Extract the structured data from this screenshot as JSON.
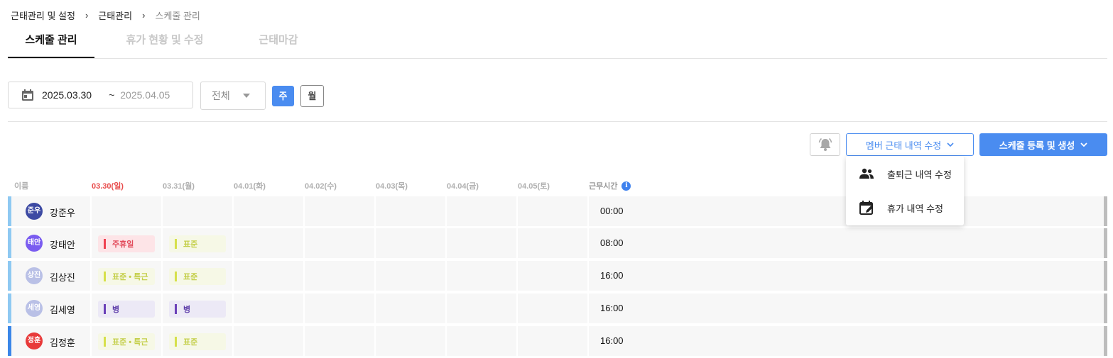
{
  "breadcrumb": [
    "근태관리 및 설정",
    "근태관리",
    "스케줄 관리"
  ],
  "tabs": [
    {
      "label": "스케줄 관리",
      "active": true
    },
    {
      "label": "휴가 현황 및 수정",
      "active": false
    },
    {
      "label": "근태마감",
      "active": false
    }
  ],
  "filter": {
    "date_from": "2025.03.30",
    "date_sep": "~",
    "date_to": "2025.04.05",
    "group_select": "전체",
    "view_week": "주",
    "view_month": "월"
  },
  "actions": {
    "bell_icon": "bell-icon",
    "member_edit": "멤버 근태 내역 수정",
    "schedule_register": "스케줄 등록 및 생성"
  },
  "dropdown": [
    {
      "label": "출퇴근 내역 수정",
      "icon": "people-icon"
    },
    {
      "label": "휴가 내역 수정",
      "icon": "calendar-edit-icon"
    }
  ],
  "table": {
    "headers": {
      "name": "이름",
      "days": [
        "03.30(일)",
        "03.31(월)",
        "04.01(화)",
        "04.02(수)",
        "04.03(목)",
        "04.04(금)",
        "04.05(토)"
      ],
      "hours": "근무시간"
    },
    "rows": [
      {
        "avatar": "준우",
        "name": "강준우",
        "avatar_color": "#3d4aa3",
        "d0": "",
        "d1": "",
        "hours": "00:00"
      },
      {
        "avatar": "태안",
        "name": "강태안",
        "avatar_color": "#7a5cf0",
        "d0": "주휴일",
        "d1": "표준",
        "hours": "08:00"
      },
      {
        "avatar": "상진",
        "name": "김상진",
        "avatar_color": "#b9c0e6",
        "d0": "표준 • 특근",
        "d1": "표준",
        "hours": "16:00"
      },
      {
        "avatar": "세영",
        "name": "김세영",
        "avatar_color": "#b9c0e6",
        "d0": "병",
        "d1": "병",
        "hours": "16:00"
      },
      {
        "avatar": "정훈",
        "name": "김정훈",
        "avatar_color": "#e83a3a",
        "d0": "표준 • 특근",
        "d1": "표준",
        "hours": "16:00"
      }
    ]
  },
  "colors": {
    "accent": "#4a8cf0",
    "today": "#e84c4c"
  }
}
